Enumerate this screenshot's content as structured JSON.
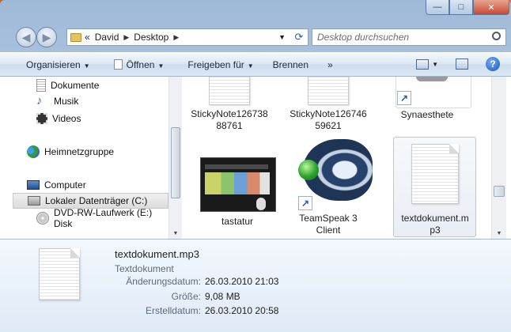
{
  "window": {
    "caption": {
      "minimize": "—",
      "maximize": "□",
      "close": "✕"
    }
  },
  "address": {
    "chevron": "«",
    "path": [
      "David",
      "Desktop"
    ],
    "refresh_icon": "refresh-icon",
    "search_placeholder": "Desktop durchsuchen"
  },
  "toolbar": {
    "organize": "Organisieren",
    "open": "Öffnen",
    "share": "Freigeben für",
    "burn": "Brennen",
    "more": "»"
  },
  "nav": {
    "items": [
      {
        "label": "Dokumente",
        "icon": "documents-icon"
      },
      {
        "label": "Musik",
        "icon": "music-icon"
      },
      {
        "label": "Videos",
        "icon": "videos-icon"
      },
      {
        "label": "Heimnetzgruppe",
        "icon": "homegroup-icon"
      },
      {
        "label": "Computer",
        "icon": "computer-icon"
      },
      {
        "label": "Lokaler Datenträger (C:)",
        "icon": "drive-icon"
      },
      {
        "label": "DVD-RW-Laufwerk (E:) Disk",
        "icon": "dvd-icon"
      }
    ]
  },
  "files": [
    {
      "name": "StickyNote12673888761",
      "line1": "StickyNote126738",
      "line2": "88761"
    },
    {
      "name": "StickyNote12674659621",
      "line1": "StickyNote126746",
      "line2": "59621"
    },
    {
      "name": "Synaesthete",
      "line1": "Synaesthete",
      "line2": ""
    },
    {
      "name": "tastatur",
      "line1": "tastatur",
      "line2": ""
    },
    {
      "name": "TeamSpeak 3 Client",
      "line1": "TeamSpeak 3",
      "line2": "Client"
    },
    {
      "name": "textdokument.mp3",
      "line1": "textdokument.m",
      "line2": "p3"
    }
  ],
  "details": {
    "title": "textdokument.mp3",
    "type": "Textdokument",
    "rows": [
      {
        "key": "Änderungsdatum:",
        "value": "26.03.2010 21:03"
      },
      {
        "key": "Größe:",
        "value": "9,08 MB"
      },
      {
        "key": "Erstelldatum:",
        "value": "26.03.2010 20:58"
      }
    ]
  },
  "colors": {
    "accent": "#1d5cb8",
    "toolbar_text": "#1e2a3c",
    "detail_key": "#5b6a7c"
  }
}
